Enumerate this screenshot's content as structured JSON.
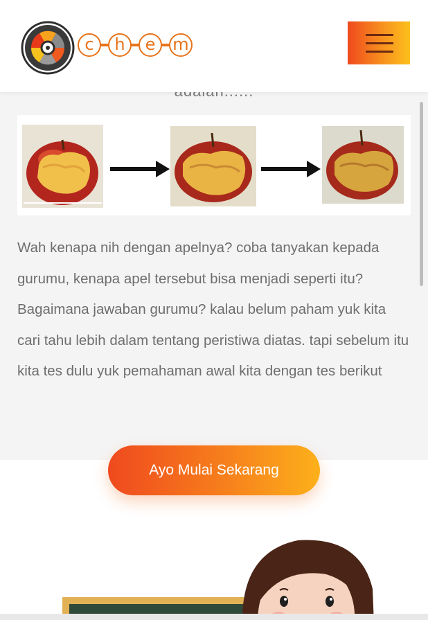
{
  "header": {
    "brand_letters": [
      "c",
      "h",
      "e",
      "m"
    ],
    "logo_icon": "radiation-icon",
    "menu_icon": "hamburger-menu-icon"
  },
  "content": {
    "cut_heading": "adalah......",
    "images": [
      {
        "name": "apple-image-1",
        "alt": "Bitten apple"
      },
      {
        "name": "apple-image-2",
        "alt": "Bitten apple turning brown"
      },
      {
        "name": "apple-image-3",
        "alt": "Browned bitten apple"
      }
    ],
    "paragraph": "Wah kenapa nih dengan apelnya? coba tanyakan kepada gurumu, kenapa apel tersebut bisa menjadi seperti itu? Bagaimana jawaban gurumu? kalau belum paham yuk kita cari tahu lebih dalam tentang peristiwa diatas. tapi sebelum itu kita tes dulu yuk pemahaman awal kita dengan tes berikut"
  },
  "cta": {
    "label": "Ayo Mulai Sekarang"
  },
  "colors": {
    "accent_start": "#ef4a1e",
    "accent_mid": "#f7901e",
    "accent_end": "#fcc01c",
    "text": "#6e6e6e",
    "section_bg": "#f4f4f4"
  }
}
